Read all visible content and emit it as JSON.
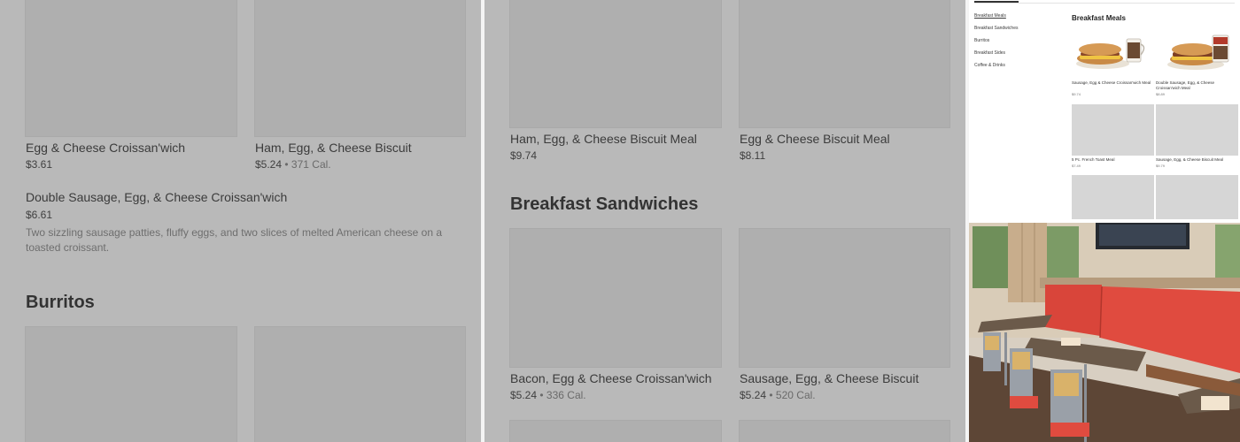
{
  "panel1": {
    "items": [
      {
        "name": "Egg & Cheese Croissan'wich",
        "price": "$3.61",
        "cal": ""
      },
      {
        "name": "Ham, Egg, & Cheese Biscuit",
        "price": "$5.24",
        "cal": "371 Cal."
      }
    ],
    "featured": {
      "name": "Double Sausage, Egg, & Cheese Croissan'wich",
      "price": "$6.61",
      "description": "Two sizzling sausage patties, fluffy eggs, and two slices of melted American cheese on a toasted croissant."
    },
    "section": "Burritos"
  },
  "panel2": {
    "items_top": [
      {
        "name": "Ham, Egg, & Cheese Biscuit Meal",
        "price": "$9.74"
      },
      {
        "name": "Egg & Cheese Biscuit Meal",
        "price": "$8.11"
      }
    ],
    "section": "Breakfast Sandwiches",
    "items_bottom": [
      {
        "name": "Bacon, Egg & Cheese Croissan'wich",
        "price": "$5.24",
        "cal": "336 Cal."
      },
      {
        "name": "Sausage, Egg, & Cheese Biscuit",
        "price": "$5.24",
        "cal": "520 Cal."
      }
    ],
    "separator": "•"
  },
  "panel3": {
    "sidebar": [
      "Breakfast Meals",
      "Breakfast Sandwiches",
      "Burritos",
      "Breakfast Sides",
      "Coffee & Drinks"
    ],
    "heading": "Breakfast Meals",
    "cards": [
      {
        "name": "Sausage, Egg & Cheese Croissan'wich Meal",
        "price": "$9.74"
      },
      {
        "name": "Double Sausage, Egg, & Cheese Croissan'wich Meal",
        "price": "$8.89"
      },
      {
        "name": "5 Pc. French Toast Meal",
        "price": "$7.49"
      },
      {
        "name": "Sausage, Egg, & Cheese Biscuit Meal",
        "price": "$9.79"
      }
    ]
  },
  "colors": {
    "overlay_grey": "#b9b9b9",
    "placeholder_grey": "#afafaf",
    "booth_red": "#d9453a",
    "table_brown": "#6b5a4a"
  }
}
